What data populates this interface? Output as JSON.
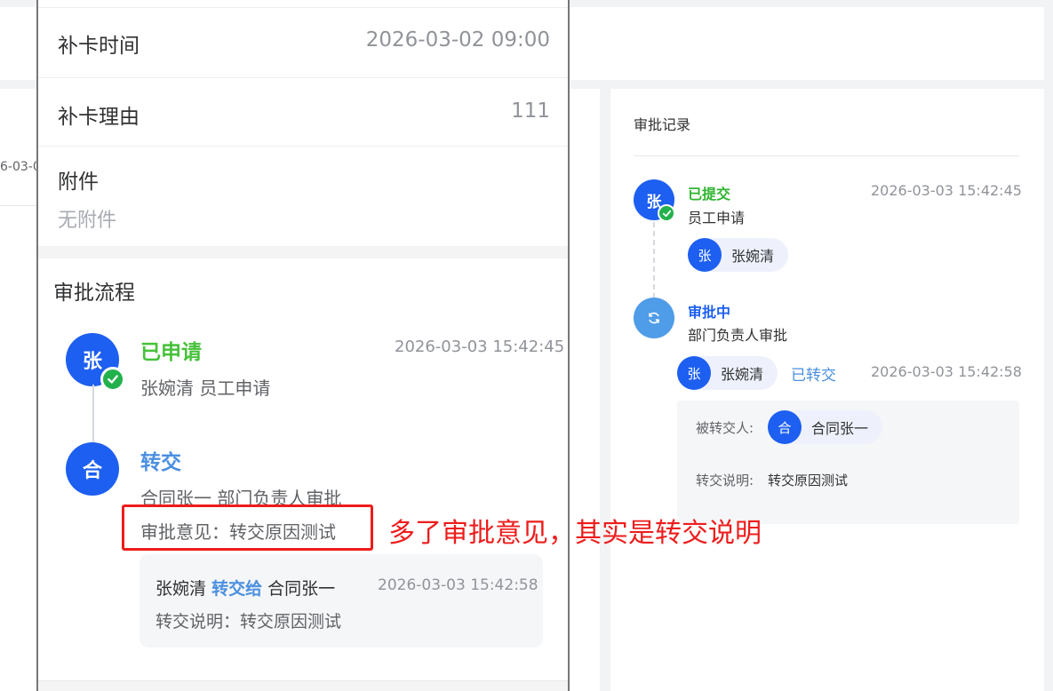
{
  "background_page": {
    "left_date_fragment": "6-03-0",
    "approval_record": {
      "title": "审批记录",
      "steps": [
        {
          "avatar": "张",
          "status": "已提交",
          "desc": "员工申请",
          "time": "2026-03-03 15:42:45",
          "user": {
            "avatar": "张",
            "name": "张婉清"
          }
        },
        {
          "status": "审批中",
          "desc": "部门负责人审批",
          "user": {
            "avatar": "张",
            "name": "张婉清"
          },
          "tag": "已转交",
          "time": "2026-03-03 15:42:58",
          "transfer_box": {
            "to_label": "被转交人:",
            "to_user": {
              "avatar": "合",
              "name": "合同张一"
            },
            "note_label": "转交说明:",
            "note_value": "转交原因测试"
          }
        }
      ]
    }
  },
  "mobile_detail": {
    "fields": [
      {
        "label": "补卡时间",
        "value": "2026-03-02 09:00"
      },
      {
        "label": "补卡理由",
        "value": "111"
      }
    ],
    "attachment": {
      "label": "附件",
      "empty_text": "无附件"
    },
    "flow": {
      "title": "审批流程",
      "steps": [
        {
          "avatar": "张",
          "status": "已申请",
          "time": "2026-03-03 15:42:45",
          "desc": "张婉清 员工申请"
        },
        {
          "avatar": "合",
          "status": "转交",
          "desc": "合同张一 部门负责人审批",
          "opinion": "审批意见：转交原因测试",
          "transfer_card": {
            "from": "张婉清",
            "action": "转交给",
            "to": "合同张一",
            "time": "2026-03-03 15:42:58",
            "note": "转交说明：转交原因测试"
          }
        }
      ]
    }
  },
  "annotation": {
    "text": "多了审批意见，其实是转交说明",
    "color": "#ee1c1c"
  },
  "colors": {
    "primary_blue": "#1d5ff0",
    "success_green": "#2fb52f",
    "link_blue": "#4a8fe0"
  }
}
